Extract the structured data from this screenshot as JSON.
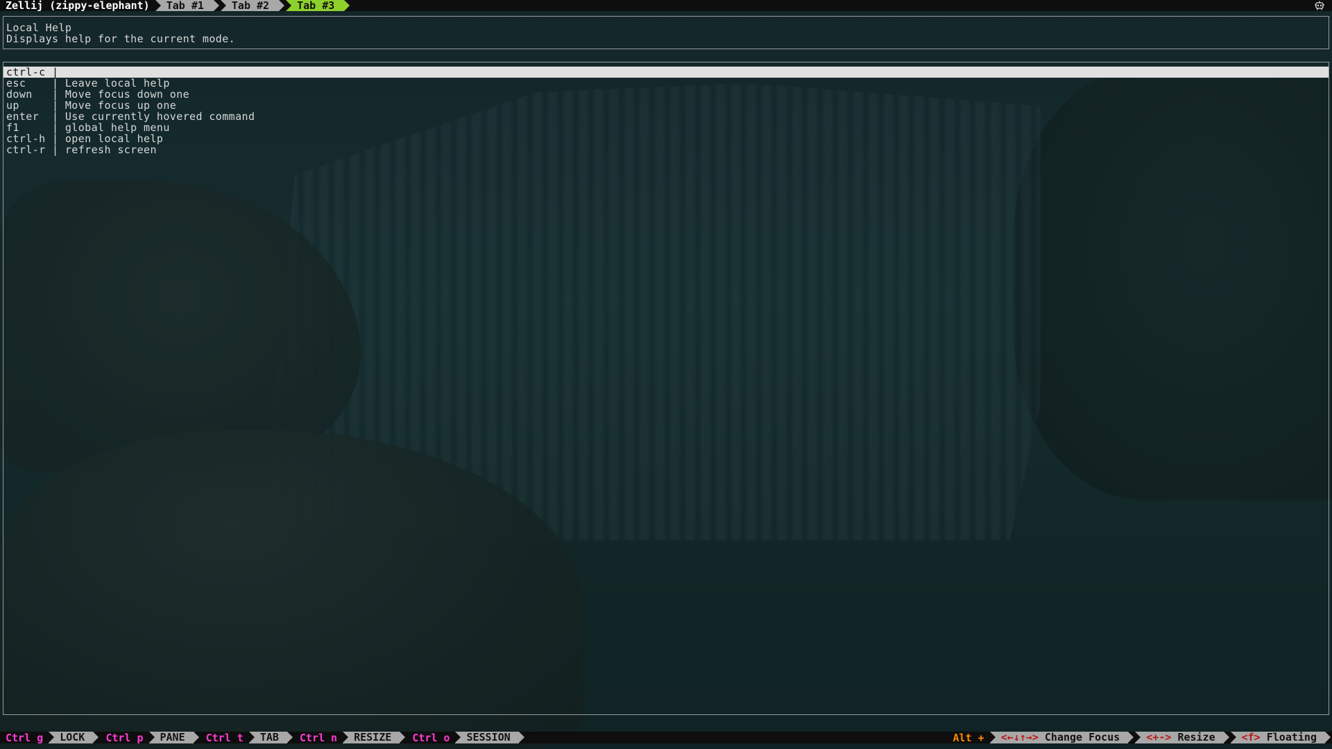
{
  "tabbar": {
    "session_title": "Zellij (zippy-elephant)",
    "tabs": [
      {
        "label": "Tab #1",
        "active": false
      },
      {
        "label": "Tab #2",
        "active": false
      },
      {
        "label": "Tab #3",
        "active": true
      }
    ],
    "active_color": "#8ed02c"
  },
  "info_pane": {
    "title": "Local Help",
    "description": "Displays help for the current mode."
  },
  "help_pane": {
    "rows": [
      {
        "text": "ctrl-c |",
        "highlighted": true
      },
      {
        "text": "esc    | Leave local help",
        "highlighted": false
      },
      {
        "text": "down   | Move focus down one",
        "highlighted": false
      },
      {
        "text": "up     | Move focus up one",
        "highlighted": false
      },
      {
        "text": "enter  | Use currently hovered command",
        "highlighted": false
      },
      {
        "text": "f1     | global help menu",
        "highlighted": false
      },
      {
        "text": "ctrl-h | open local help",
        "highlighted": false
      },
      {
        "text": "ctrl-r | refresh screen",
        "highlighted": false
      }
    ]
  },
  "statusbar": {
    "modes": [
      {
        "key": "Ctrl g",
        "label": "LOCK"
      },
      {
        "key": "Ctrl p",
        "label": "PANE"
      },
      {
        "key": "Ctrl t",
        "label": "TAB"
      },
      {
        "key": "Ctrl n",
        "label": "RESIZE"
      },
      {
        "key": "Ctrl o",
        "label": "SESSION"
      }
    ],
    "alt_label": "Alt +",
    "hints": [
      {
        "key": "<←↓↑→>",
        "label": "Change Focus"
      },
      {
        "key": "<+->",
        "label": "Resize"
      },
      {
        "key": "<f>",
        "label": "Floating"
      }
    ],
    "key_color": "#ff3bd2",
    "alt_color": "#ff8a00"
  },
  "icons": {
    "corner": "robot-icon"
  }
}
